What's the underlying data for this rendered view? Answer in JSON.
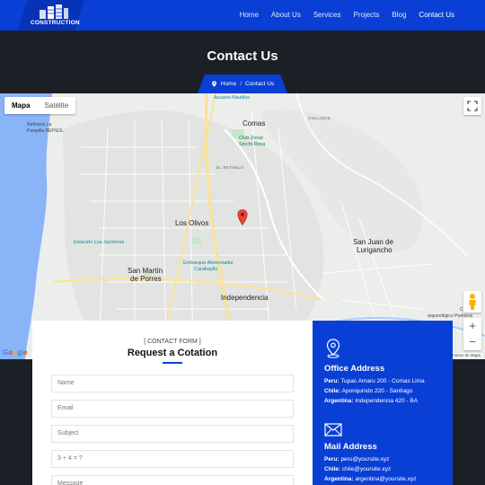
{
  "nav": {
    "logo_text": "CONSTRUCTION",
    "items": [
      {
        "label": "Home"
      },
      {
        "label": "About Us"
      },
      {
        "label": "Services"
      },
      {
        "label": "Projects"
      },
      {
        "label": "Blog"
      },
      {
        "label": "Contact Us",
        "active": true
      }
    ]
  },
  "hero": {
    "title": "Contact Us",
    "breadcrumb": {
      "home": "Home",
      "separator": "/",
      "current": "Contact Us"
    }
  },
  "map": {
    "tabs": [
      "Mapa",
      "Satélite"
    ],
    "active_tab": "Mapa",
    "labels": {
      "comas": "Comas",
      "los_olivos": "Los Olivos",
      "san_martin_1": "San Martín",
      "san_martin_2": "de Porres",
      "independencia": "Independencia",
      "sjl_1": "San Juan de",
      "sjl_2": "Lurigancho",
      "el_retablo": "EL RETABLO",
      "collique": "COLLIQUE",
      "acuario": "Acuario Nautilus",
      "club_1": "Club Zonal",
      "club_2": "Sinchi Roca",
      "refineria_1": "Refinería La",
      "refineria_2": "Pampilla REPSOL",
      "estacion": "Estación Los Jazmines",
      "embarque_1": "Embarque Alimentador",
      "embarque_2": "Carabayllo",
      "complejo_1": "Complejo",
      "complejo_2": "arqueológico Pedreros",
      "av_label": "Av. Tupac Amaru"
    },
    "zoom_in": "+",
    "zoom_out": "−",
    "google": [
      "G",
      "o",
      "o",
      "g",
      "l",
      "e"
    ],
    "terms": "Términos de Mapa",
    "colors": {
      "land": "#eceeec",
      "water": "#8ab4f8",
      "park": "#c8e6c9",
      "road": "#ffffff",
      "highway": "#fde293",
      "marker": "#ea4335"
    }
  },
  "form": {
    "kicker": "[ CONTACT FORM ]",
    "title": "Request a Cotation",
    "placeholders": {
      "name": "Name",
      "email": "Email",
      "subject": "Subject",
      "captcha": "3 + 4 = ?",
      "message": "Message"
    }
  },
  "office": {
    "title": "Office Address",
    "rows": [
      {
        "label": "Peru:",
        "value": "Tupac Amaru 200 - Comas Lima"
      },
      {
        "label": "Chile:",
        "value": "Aponquindo 220 - Santiago"
      },
      {
        "label": "Argentina:",
        "value": "Independencia 420 - BA"
      }
    ]
  },
  "mail": {
    "title": "Mail Address",
    "rows": [
      {
        "label": "Peru:",
        "value": "peru@yoursite.xyz"
      },
      {
        "label": "Chile:",
        "value": "chile@yoursite.xyz"
      },
      {
        "label": "Argentina:",
        "value": "argentina@yoursite.xyz"
      }
    ]
  },
  "colors": {
    "brand_blue": "#0a3fd6",
    "dark_bg": "#1b2026"
  }
}
